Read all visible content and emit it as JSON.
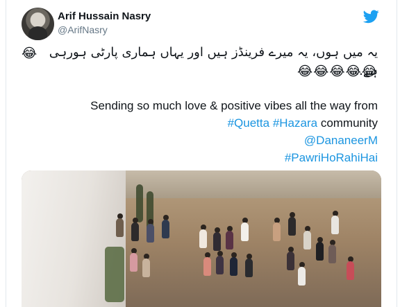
{
  "user": {
    "name": "Arif Hussain Nasry",
    "handle": "@ArifNasry"
  },
  "tweet": {
    "urdu_text": "یہ میں ہوں، یہ میرے فرینڈز ہیں اور یہاں ہماری پارٹی ہورہی ہے...",
    "emoji_single": "😂",
    "emoji_row": "😂😂😂😂😂",
    "english_line": "Sending so much love & positive vibes all the way from",
    "hashtag_quetta": "#Quetta",
    "hashtag_hazara": "#Hazara",
    "community": "community",
    "mention": "@DananeerM",
    "hashtag_pawri": "#PawriHoRahiHai"
  },
  "icons": {
    "brand": "twitter-bird-icon"
  },
  "colors": {
    "link": "#1b95e0",
    "twitter_blue": "#1da1f2",
    "text": "#0f1419",
    "secondary": "#657786"
  }
}
